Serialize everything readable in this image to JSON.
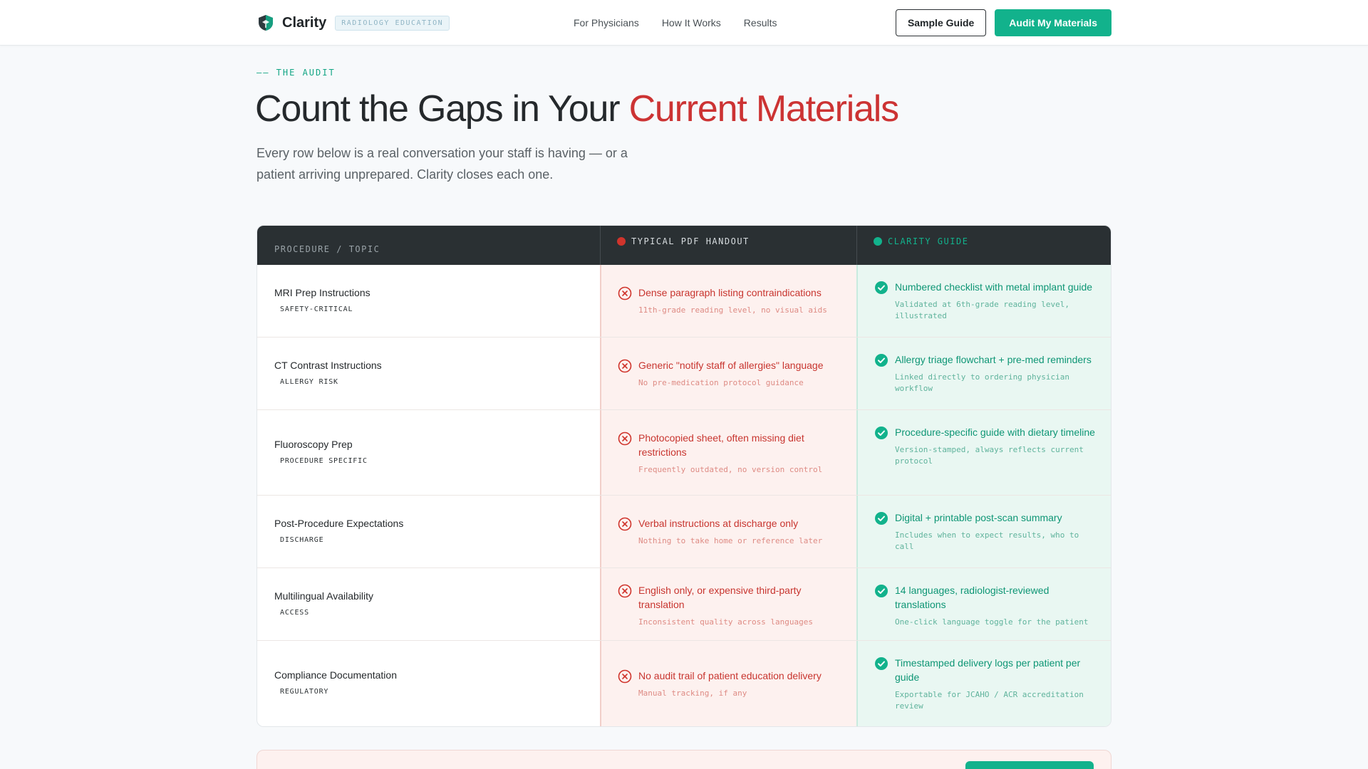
{
  "nav": {
    "brand": "Clarity",
    "tag": "RADIOLOGY EDUCATION",
    "links": [
      "For Physicians",
      "How It Works",
      "Results"
    ],
    "sample_label": "Sample Guide",
    "audit_label": "Audit My Materials"
  },
  "hero": {
    "eyebrow": "—— THE AUDIT",
    "title_main": "Count the Gaps in Your ",
    "title_accent": "Current Materials",
    "subtitle": "Every row below is a real conversation your staff is having — or a patient arriving unprepared. Clarity closes each one."
  },
  "table": {
    "headers": {
      "topic": "PROCEDURE / TOPIC",
      "typical": "TYPICAL PDF HANDOUT",
      "clarity": "CLARITY GUIDE"
    },
    "rows": [
      {
        "topic": "MRI Prep Instructions",
        "badge": "SAFETY-CRITICAL",
        "bad": "Dense paragraph listing contraindications",
        "bad_sub": "11th-grade reading level, no visual aids",
        "good": "Numbered checklist with metal implant guide",
        "good_sub": "Validated at 6th-grade reading level, illustrated"
      },
      {
        "topic": "CT Contrast Instructions",
        "badge": "ALLERGY RISK",
        "bad": "Generic \"notify staff of allergies\" language",
        "bad_sub": "No pre-medication protocol guidance",
        "good": "Allergy triage flowchart + pre-med reminders",
        "good_sub": "Linked directly to ordering physician workflow"
      },
      {
        "topic": "Fluoroscopy Prep",
        "badge": "PROCEDURE SPECIFIC",
        "bad": "Photocopied sheet, often missing diet restrictions",
        "bad_sub": "Frequently outdated, no version control",
        "good": "Procedure-specific guide with dietary timeline",
        "good_sub": "Version-stamped, always reflects current protocol"
      },
      {
        "topic": "Post-Procedure Expectations",
        "badge": "DISCHARGE",
        "bad": "Verbal instructions at discharge only",
        "bad_sub": "Nothing to take home or reference later",
        "good": "Digital + printable post-scan summary",
        "good_sub": "Includes when to expect results, who to call"
      },
      {
        "topic": "Multilingual Availability",
        "badge": "ACCESS",
        "bad": "English only, or expensive third-party translation",
        "bad_sub": "Inconsistent quality across languages",
        "good": "14 languages, radiologist-reviewed translations",
        "good_sub": "One-click language toggle for the patient"
      },
      {
        "topic": "Compliance Documentation",
        "badge": "REGULATORY",
        "bad": "No audit trail of patient education delivery",
        "bad_sub": "Manual tracking, if any",
        "good": "Timestamped delivery logs per patient per guide",
        "good_sub": "Exportable for JCAHO / ACR accreditation review"
      }
    ]
  },
  "colors": {
    "accent_green": "#12b28c",
    "accent_red": "#cc3333",
    "header_dark": "#2a3033"
  },
  "icons": {
    "logo": "shield-logo-icon",
    "bad": "x-circle-icon",
    "good": "check-circle-icon"
  }
}
